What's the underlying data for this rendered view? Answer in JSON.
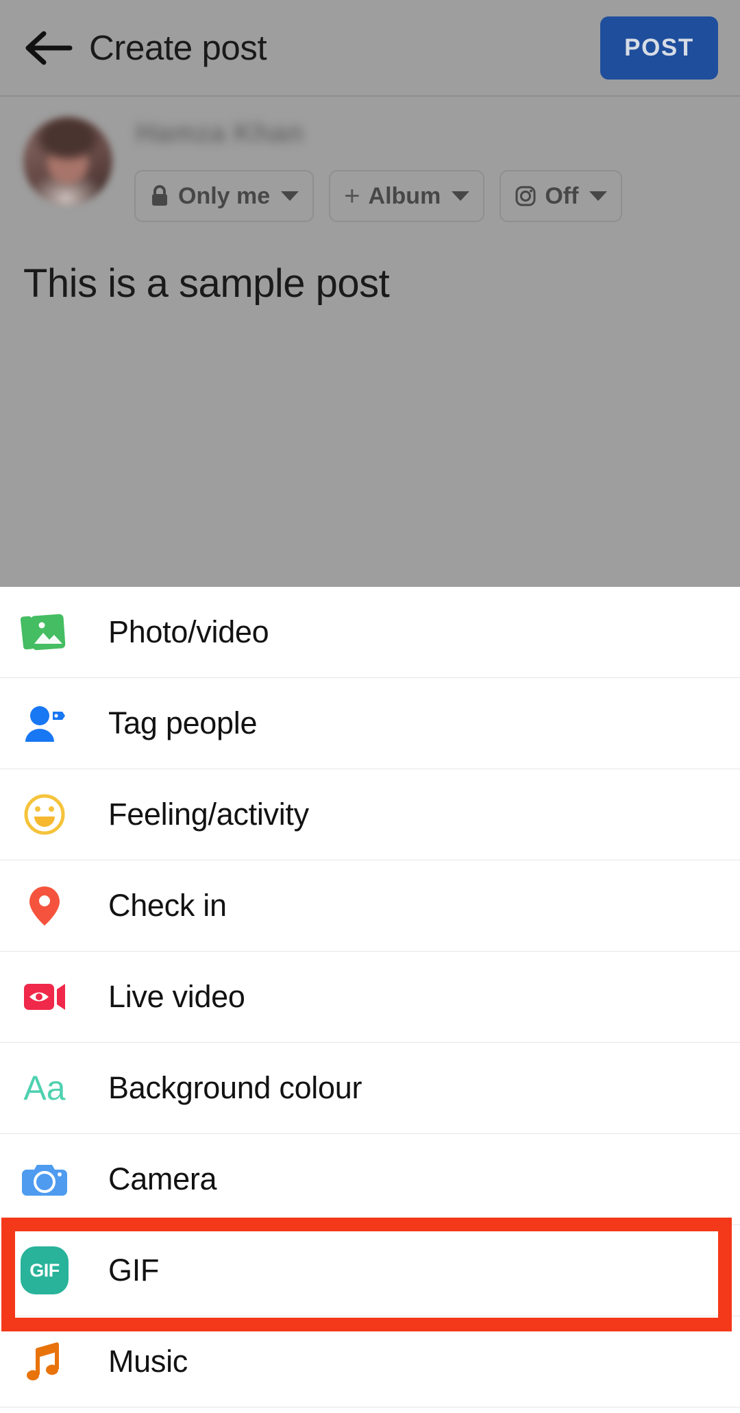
{
  "header": {
    "back_icon": "arrow-left-icon",
    "title": "Create post",
    "post_label": "POST",
    "post_bg": "#1f4e9c"
  },
  "composer": {
    "author_name": "Hamza Khan",
    "avatar_icon": "user-avatar-photo",
    "text": "This is a sample post",
    "chips": [
      {
        "icon": "lock-icon",
        "label": "Only me",
        "caret": true
      },
      {
        "icon": "plus-icon",
        "label": "Album",
        "caret": true
      },
      {
        "icon": "instagram-icon",
        "label": "Off",
        "caret": true
      }
    ]
  },
  "sheet": {
    "items": [
      {
        "label": "Photo/video",
        "icon": "photo-video-icon",
        "color": "#45BD62",
        "highlighted": false
      },
      {
        "label": "Tag people",
        "icon": "tag-people-icon",
        "color": "#1877F2",
        "highlighted": false
      },
      {
        "label": "Feeling/activity",
        "icon": "feeling-activity-icon",
        "color": "#F5C33B",
        "highlighted": false
      },
      {
        "label": "Check in",
        "icon": "location-pin-icon",
        "color": "#F5533D",
        "highlighted": false
      },
      {
        "label": "Live video",
        "icon": "live-video-icon",
        "color": "#F02849",
        "highlighted": false
      },
      {
        "label": "Background colour",
        "icon": "background-colour-icon",
        "color": "#4FD1B0",
        "highlighted": false
      },
      {
        "label": "Camera",
        "icon": "camera-icon",
        "color": "#4E9BF0",
        "highlighted": false
      },
      {
        "label": "GIF",
        "icon": "gif-icon",
        "color": "#28B39A",
        "highlighted": true
      },
      {
        "label": "Music",
        "icon": "music-note-icon",
        "color": "#E8730B",
        "highlighted": false
      }
    ]
  },
  "annotation": {
    "highlight_color": "#F4381A",
    "highlight_target": "GIF"
  }
}
